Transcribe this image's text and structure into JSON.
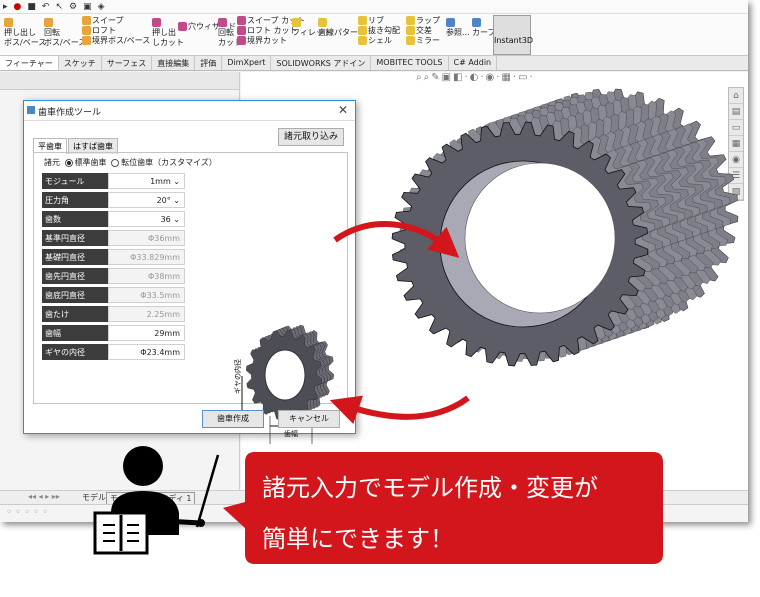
{
  "ribbon": {
    "groups": [
      {
        "lines": [
          "押し出し",
          "ボス/ベース"
        ]
      },
      {
        "lines": [
          "回転",
          "ボス/ベース"
        ]
      },
      {
        "lines": [
          "スイープ",
          "ロフト",
          "境界ボス/ベース"
        ]
      },
      {
        "lines": [
          "押し出",
          "しカット"
        ]
      },
      {
        "lines": [
          "穴ウィザード"
        ]
      },
      {
        "lines": [
          "回転",
          "カット"
        ]
      },
      {
        "lines": [
          "スイープ カット",
          "ロフト カット",
          "境界カット"
        ]
      },
      {
        "lines": [
          "フィレット"
        ]
      },
      {
        "lines": [
          "直線パターン"
        ]
      },
      {
        "lines": [
          "リブ",
          "抜き勾配",
          "シェル"
        ]
      },
      {
        "lines": [
          "ラップ",
          "交差",
          "ミラー"
        ]
      },
      {
        "lines": [
          "参照..."
        ]
      },
      {
        "lines": [
          "カーブ"
        ]
      }
    ],
    "instant3d": "Instant3D"
  },
  "tabs": [
    "フィーチャー",
    "スケッチ",
    "サーフェス",
    "直接編集",
    "評価",
    "DimXpert",
    "SOLIDWORKS アドイン",
    "MOBITEC TOOLS",
    "C# Addin"
  ],
  "status": {
    "model_tab": "モデル",
    "motion_tab": "モーション スタディ 1"
  },
  "dialog": {
    "title": "歯車作成ツール",
    "load_button": "諸元取り込み",
    "tabs": [
      "平歯車",
      "はすば歯車"
    ],
    "spec_label": "諸元",
    "radio_standard": "標準歯車",
    "radio_shifted": "転位歯車（カスタマイズ）",
    "params": [
      {
        "label": "モジュール",
        "value": "1mm",
        "dropdown": true,
        "disabled": false
      },
      {
        "label": "圧力角",
        "value": "20°",
        "dropdown": true,
        "disabled": false
      },
      {
        "label": "歯数",
        "value": "36",
        "dropdown": true,
        "disabled": false
      },
      {
        "label": "基準円直径",
        "value": "Φ36mm",
        "dropdown": false,
        "disabled": true
      },
      {
        "label": "基礎円直径",
        "value": "Φ33.829mm",
        "dropdown": false,
        "disabled": true
      },
      {
        "label": "歯先円直径",
        "value": "Φ38mm",
        "dropdown": false,
        "disabled": true
      },
      {
        "label": "歯底円直径",
        "value": "Φ33.5mm",
        "dropdown": false,
        "disabled": true
      },
      {
        "label": "歯たけ",
        "value": "2.25mm",
        "dropdown": false,
        "disabled": true
      },
      {
        "label": "歯幅",
        "value": "29mm",
        "dropdown": false,
        "disabled": false
      },
      {
        "label": "ギヤの内径",
        "value": "Φ23.4mm",
        "dropdown": false,
        "disabled": false
      }
    ],
    "preview_bore_label": "ギヤの内径",
    "preview_width_label": "歯幅",
    "create_button": "歯車作成",
    "cancel_button": "キャンセル"
  },
  "callout": {
    "line1": "諸元入力でモデル作成・変更が",
    "line2": "簡単にできます！",
    "color": "#d3161b"
  }
}
